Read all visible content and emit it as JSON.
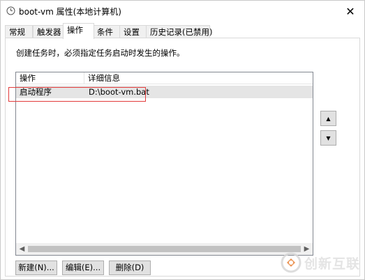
{
  "window": {
    "title": "boot-vm 属性(本地计算机)",
    "close_glyph": "✕",
    "icon": "clock-icon"
  },
  "tabs": [
    {
      "label": "常规"
    },
    {
      "label": "触发器"
    },
    {
      "label": "操作",
      "active": true
    },
    {
      "label": "条件"
    },
    {
      "label": "设置"
    },
    {
      "label": "历史记录(已禁用)"
    }
  ],
  "panel": {
    "description": "创建任务时，必须指定任务启动时发生的操作。"
  },
  "actions_table": {
    "columns": [
      "操作",
      "详细信息"
    ],
    "rows": [
      {
        "action": "启动程序",
        "details": "D:\\boot-vm.bat",
        "selected": true
      }
    ]
  },
  "buttons": {
    "new": "新建(N)...",
    "edit": "编辑(E)...",
    "delete": "删除(D)",
    "move_up_glyph": "▲",
    "move_down_glyph": "▼"
  },
  "watermark": {
    "text": "创新互联"
  },
  "colors": {
    "selection_row": "#e5e5e5",
    "highlight_box": "#e23b3b",
    "button_face": "#e1e1e1"
  }
}
